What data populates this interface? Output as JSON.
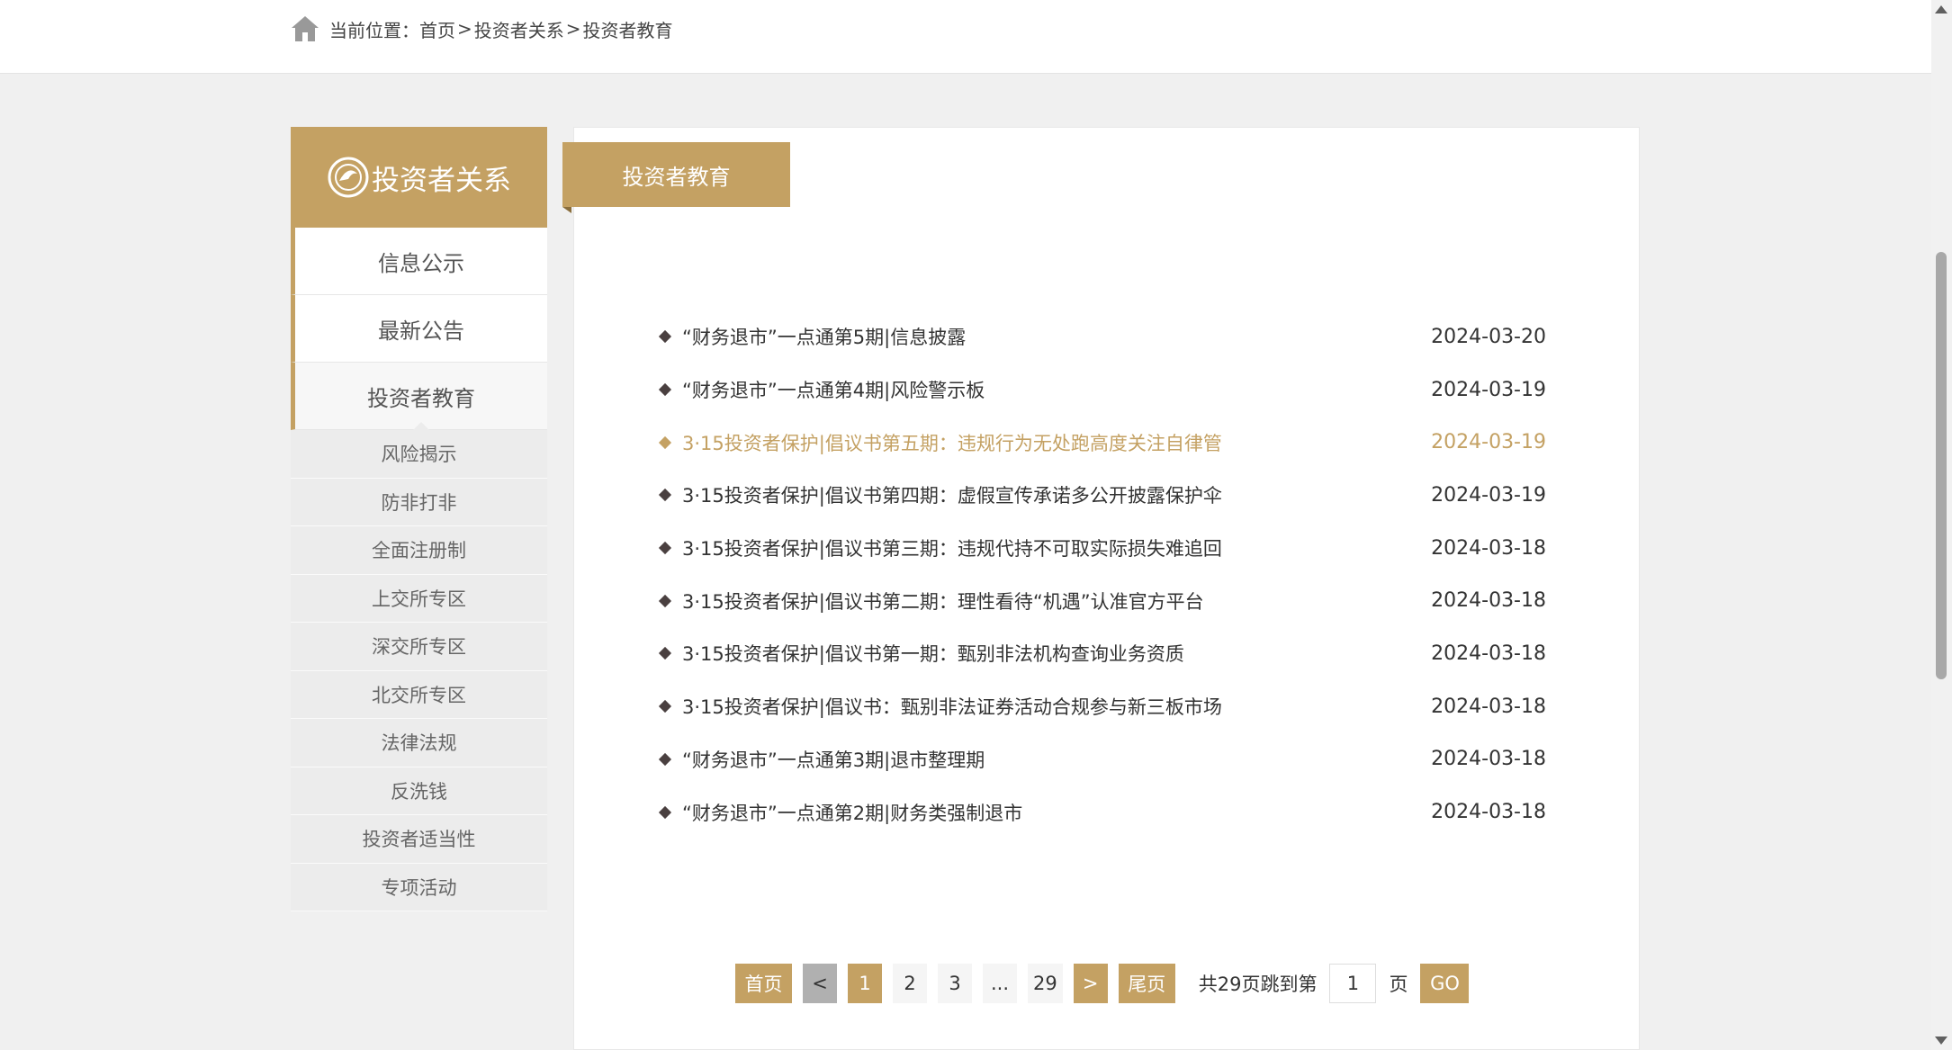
{
  "breadcrumb": {
    "prefix": "当前位置：",
    "items": [
      "首页",
      "投资者关系",
      "投资者教育"
    ],
    "sep": ">"
  },
  "sidebar": {
    "title": "投资者关系",
    "items": [
      {
        "label": "信息公示",
        "active": false
      },
      {
        "label": "最新公告",
        "active": false
      },
      {
        "label": "投资者教育",
        "active": true
      }
    ],
    "sub_items": [
      "风险揭示",
      "防非打非",
      "全面注册制",
      "上交所专区",
      "深交所专区",
      "北交所专区",
      "法律法规",
      "反洗钱",
      "投资者适当性",
      "专项活动"
    ]
  },
  "panel": {
    "tab_label": "投资者教育"
  },
  "news": [
    {
      "title": "“财务退市”一点通第5期|信息披露",
      "date": "2024-03-20",
      "highlight": false
    },
    {
      "title": "“财务退市”一点通第4期|风险警示板",
      "date": "2024-03-19",
      "highlight": false
    },
    {
      "title": "3·15投资者保护|倡议书第五期：违规行为无处跑高度关注自律管",
      "date": "2024-03-19",
      "highlight": true
    },
    {
      "title": "3·15投资者保护|倡议书第四期：虚假宣传承诺多公开披露保护伞",
      "date": "2024-03-19",
      "highlight": false
    },
    {
      "title": "3·15投资者保护|倡议书第三期：违规代持不可取实际损失难追回",
      "date": "2024-03-18",
      "highlight": false
    },
    {
      "title": "3·15投资者保护|倡议书第二期：理性看待“机遇”认准官方平台",
      "date": "2024-03-18",
      "highlight": false
    },
    {
      "title": "3·15投资者保护|倡议书第一期：甄别非法机构查询业务资质",
      "date": "2024-03-18",
      "highlight": false
    },
    {
      "title": "3·15投资者保护|倡议书：甄别非法证券活动合规参与新三板市场",
      "date": "2024-03-18",
      "highlight": false
    },
    {
      "title": "“财务退市”一点通第3期|退市整理期",
      "date": "2024-03-18",
      "highlight": false
    },
    {
      "title": "“财务退市”一点通第2期|财务类强制退市",
      "date": "2024-03-18",
      "highlight": false
    }
  ],
  "pager": {
    "first": "首页",
    "prev": "<",
    "pages": [
      "1",
      "2",
      "3",
      "...",
      "29"
    ],
    "current": "1",
    "next": ">",
    "last": "尾页",
    "total_text": "共29页跳到第",
    "jump_value": "1",
    "page_suffix": "页",
    "go": "GO"
  },
  "colors": {
    "accent": "#c4a163",
    "bg": "#f0f0f0"
  },
  "icons": {
    "home": "home-icon",
    "logo": "company-logo-icon",
    "bullet": "diamond-bullet-icon"
  }
}
